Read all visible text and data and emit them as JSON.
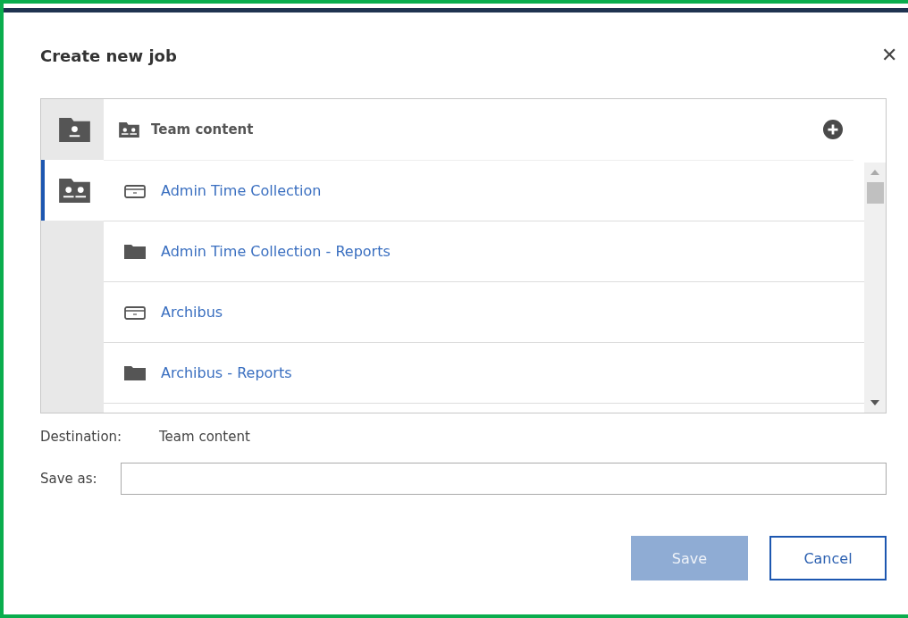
{
  "dialog": {
    "title": "Create new job",
    "close": "✕"
  },
  "sidebar": {
    "items": [
      {
        "kind": "personal",
        "selected": false
      },
      {
        "kind": "team",
        "selected": true
      }
    ]
  },
  "browser": {
    "header": "Team content",
    "items": [
      {
        "kind": "package",
        "label": "Admin Time Collection"
      },
      {
        "kind": "folder",
        "label": "Admin Time Collection - Reports"
      },
      {
        "kind": "package",
        "label": "Archibus"
      },
      {
        "kind": "folder",
        "label": "Archibus - Reports"
      }
    ]
  },
  "destination": {
    "label": "Destination:",
    "value": "Team content"
  },
  "save_as": {
    "label": "Save as:"
  },
  "buttons": [
    {
      "kind": "primary",
      "label": "Save",
      "disabled": true
    },
    {
      "kind": "secondary",
      "label": "Cancel",
      "disabled": false
    }
  ]
}
